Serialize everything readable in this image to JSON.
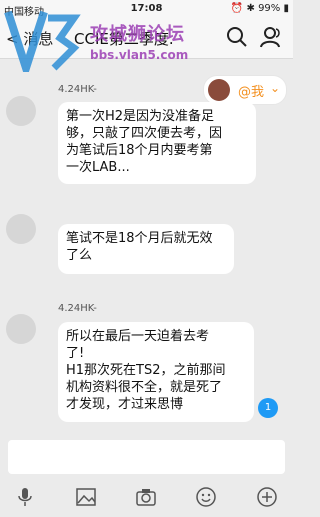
{
  "status_bar": {
    "carrier": "中国移动",
    "time": "17:08",
    "battery": "99%",
    "icons": [
      "signal-icon",
      "wifi-icon",
      "alarm-icon",
      "bluetooth-icon",
      "battery-icon"
    ]
  },
  "nav": {
    "back_label": "消息",
    "title": "CCIE第二季度.",
    "icons": [
      "search-icon",
      "group-members-icon"
    ]
  },
  "watermark": {
    "title": "攻城狮论坛",
    "url": "bbs.vlan5.com"
  },
  "me_tag": {
    "label": "@我",
    "icon": "chevron-down-icon"
  },
  "messages": [
    {
      "time_label": "4.24HK-",
      "lines": [
        "第一次H2是因为没准备足",
        "够，只敲了四次便去考，因",
        "为笔试后18个月内要考第",
        "一次LAB..."
      ]
    },
    {
      "time_label": "",
      "lines": [
        "笔试不是18个月后就无效",
        "了么"
      ]
    },
    {
      "time_label": "4.24HK-",
      "lines": [
        "所以在最后一天迫着去考",
        "了!",
        "H1那次死在TS2，之前那间",
        "机构资料很不全，就是死了",
        "才发现，才过来思博"
      ]
    }
  ],
  "unread_badge": "1",
  "input": {
    "placeholder": ""
  },
  "toolbar": {
    "icons": [
      "microphone-icon",
      "image-icon",
      "camera-icon",
      "emoji-icon",
      "plus-icon"
    ]
  },
  "colors": {
    "background": "#ebebeb",
    "bubble": "#ffffff",
    "accent_orange": "#f39020",
    "badge_blue": "#1e9af5",
    "watermark_purple": "#9c3fb5"
  }
}
